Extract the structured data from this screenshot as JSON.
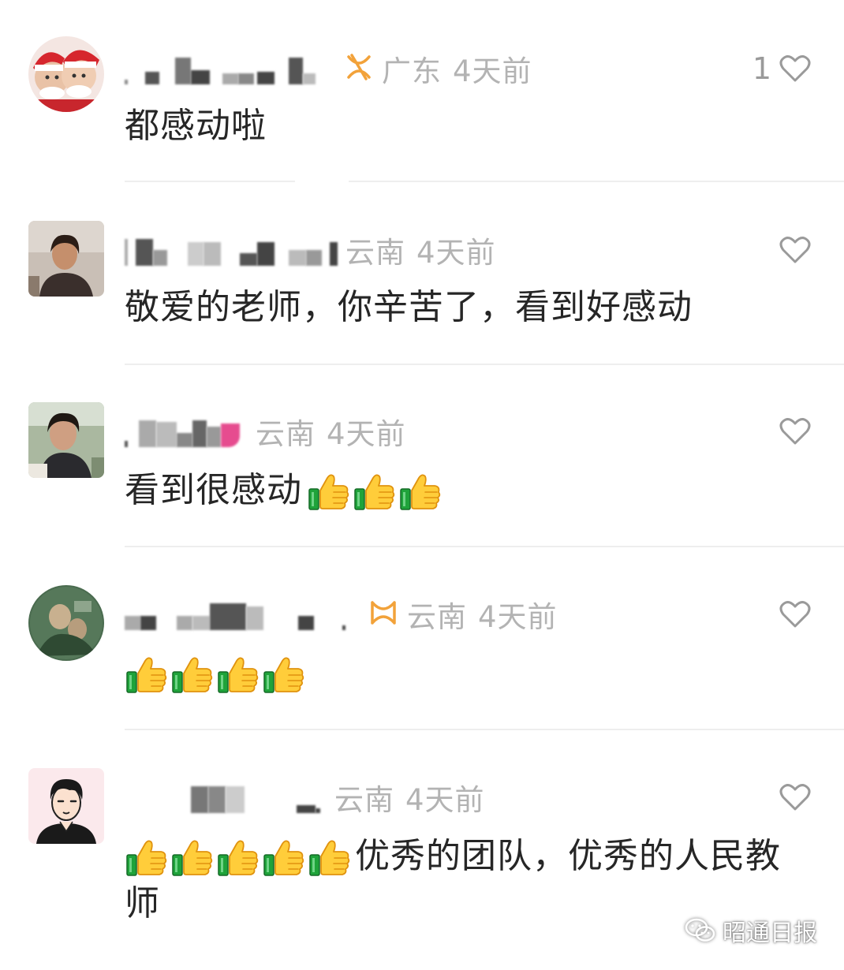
{
  "comments": [
    {
      "region": "广东",
      "time": "4天前",
      "likes": "1",
      "text": "都感动啦",
      "thumbs_count": 0,
      "has_badge": true
    },
    {
      "region": "云南",
      "time": "4天前",
      "likes": "",
      "text": "敬爱的老师，你辛苦了，看到好感动",
      "thumbs_count": 0,
      "has_badge": false
    },
    {
      "region": "云南",
      "time": "4天前",
      "likes": "",
      "text": "看到很感动",
      "thumbs_count": 3,
      "has_badge": false
    },
    {
      "region": "云南",
      "time": "4天前",
      "likes": "",
      "text": "",
      "thumbs_count": 4,
      "has_badge": true
    },
    {
      "region": "云南",
      "time": "4天前",
      "likes": "",
      "text": "优秀的团队，优秀的人民教师",
      "thumbs_count": 5,
      "has_badge": false
    }
  ],
  "watermark": {
    "label": "昭通日报",
    "icon": "wechat-icon"
  },
  "colors": {
    "badge": "#f2a23a",
    "meta_text": "#b3b3b3",
    "body_text": "#262626",
    "heart": "#9a9a9a",
    "divider": "#eeeeee"
  }
}
